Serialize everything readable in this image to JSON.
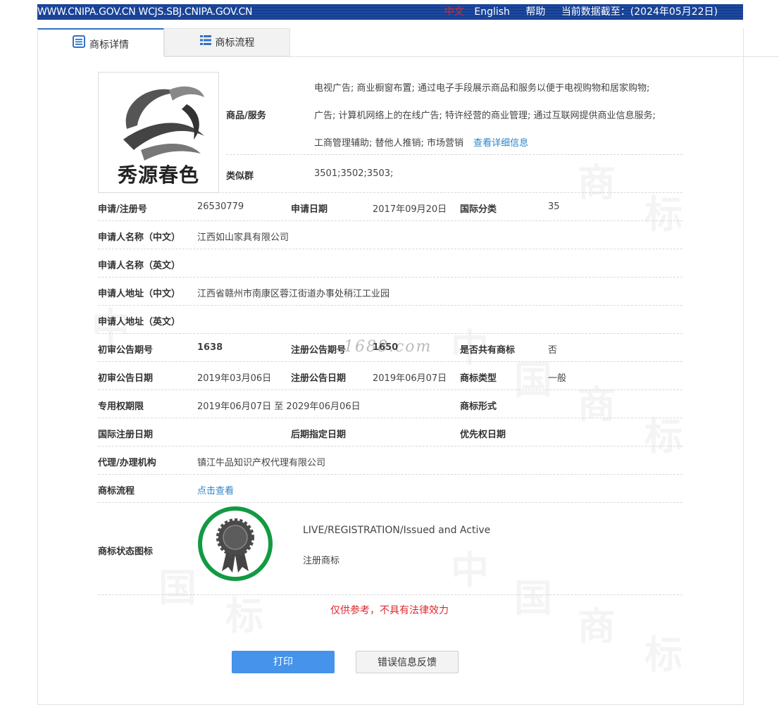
{
  "topbar": {
    "sites": "WWW.CNIPA.GOV.CN WCJS.SBJ.CNIPA.GOV.CN",
    "lang_zh": "中文",
    "lang_en": "English",
    "help": "帮助",
    "data_date": "当前数据截至：(2024年05月22日)"
  },
  "tabs": [
    {
      "label": "商标详情",
      "icon": "document-list-icon"
    },
    {
      "label": "商标流程",
      "icon": "list-icon"
    }
  ],
  "logo": {
    "text": "秀源春色"
  },
  "goods_services": {
    "label": "商品/服务",
    "lines": [
      "电视广告; 商业橱窗布置; 通过电子手段展示商品和服务以便于电视购物和居家购物;",
      "广告; 计算机网络上的在线广告; 特许经营的商业管理; 通过互联网提供商业信息服务;",
      "工商管理辅助; 替他人推销; 市场营销"
    ],
    "detail_link": "查看详细信息"
  },
  "similar_group": {
    "label": "类似群",
    "value": "3501;3502;3503;"
  },
  "fields": {
    "reg_no_label": "申请/注册号",
    "reg_no": "26530779",
    "apply_date_label": "申请日期",
    "apply_date": "2017年09月20日",
    "intl_class_label": "国际分类",
    "intl_class": "35",
    "applicant_cn_label": "申请人名称（中文）",
    "applicant_cn": "江西如山家具有限公司",
    "applicant_en_label": "申请人名称（英文）",
    "applicant_en": "",
    "address_cn_label": "申请人地址（中文）",
    "address_cn": "江西省赣州市南康区蓉江街道办事处稍江工业园",
    "address_en_label": "申请人地址（英文）",
    "address_en": "",
    "prelim_no_label": "初审公告期号",
    "prelim_no": "1638",
    "reg_pub_no_label": "注册公告期号",
    "reg_pub_no": "1650",
    "shared_label": "是否共有商标",
    "shared": "否",
    "prelim_date_label": "初审公告日期",
    "prelim_date": "2019年03月06日",
    "reg_pub_date_label": "注册公告日期",
    "reg_pub_date": "2019年06月07日",
    "mark_type_label": "商标类型",
    "mark_type": "一般",
    "exclusive_label": "专用权期限",
    "exclusive": "2019年06月07日 至 2029年06月06日",
    "mark_form_label": "商标形式",
    "mark_form": "",
    "intl_reg_date_label": "国际注册日期",
    "intl_reg_date": "",
    "later_designation_label": "后期指定日期",
    "later_designation": "",
    "priority_label": "优先权日期",
    "priority": "",
    "agent_label": "代理/办理机构",
    "agent": "镇江牛品知识产权代理有限公司",
    "flow_label": "商标流程",
    "flow_link": "点击查看",
    "status_icon_label": "商标状态图标"
  },
  "status": {
    "en": "LIVE/REGISTRATION/Issued and Active",
    "cn": "注册商标",
    "badge_color": "#129a43"
  },
  "watermark_site": "1688.com",
  "notice": "仅供参考，不具有法律效力",
  "buttons": {
    "print": "打印",
    "feedback": "错误信息反馈"
  }
}
